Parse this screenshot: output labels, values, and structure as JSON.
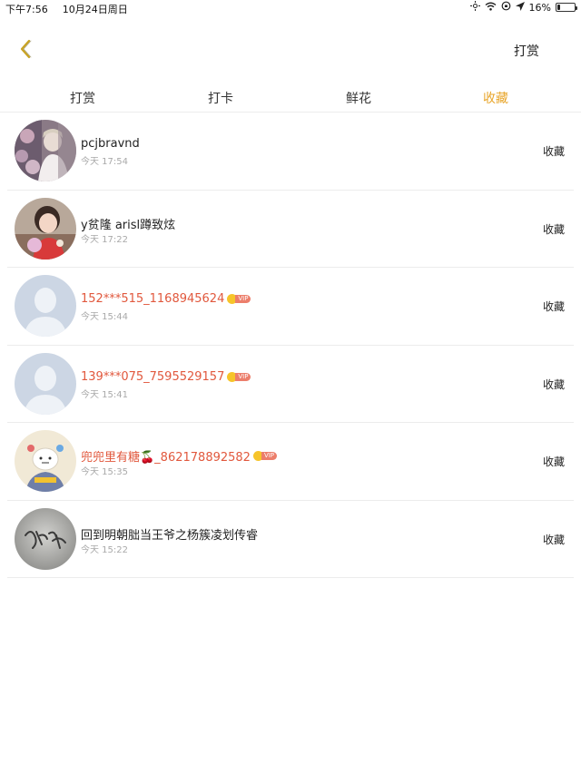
{
  "status_bar": {
    "time": "下午7:56",
    "date": "10月24日周日",
    "battery_percent": "16%",
    "battery_level": 0.16,
    "icons": [
      "moon-icon",
      "wifi-icon",
      "lock-rotation-icon",
      "location-arrow-icon",
      "battery-icon"
    ]
  },
  "nav": {
    "back_icon": "chevron-left-icon",
    "action_label": "打赏",
    "accent_color": "#e8a52a"
  },
  "tabs": [
    {
      "label": "打赏",
      "active": false
    },
    {
      "label": "打卡",
      "active": false
    },
    {
      "label": "鲜花",
      "active": false
    },
    {
      "label": "收藏",
      "active": true
    }
  ],
  "list": [
    {
      "name": "pcjbravnd",
      "time": "今天 17:54",
      "action": "收藏",
      "vip": false
    },
    {
      "name": "y贫隆 arisl蹲致炫",
      "time": "今天 17:22",
      "action": "收藏",
      "vip": false
    },
    {
      "name": "152***515_1168945624",
      "time": "今天 15:44",
      "action": "收藏",
      "vip": true,
      "vip_label": "VIP"
    },
    {
      "name": "139***075_7595529157",
      "time": "今天 15:41",
      "action": "收藏",
      "vip": true,
      "vip_label": "VIP"
    },
    {
      "name": "兜兜里有糖🍒_862178892582",
      "time": "今天 15:35",
      "action": "收藏",
      "vip": true,
      "vip_label": "VIP"
    },
    {
      "name": "回到明朝朏当王爷之杨簇凌划传睿",
      "time": "今天 15:22",
      "action": "收藏",
      "vip": false
    }
  ]
}
